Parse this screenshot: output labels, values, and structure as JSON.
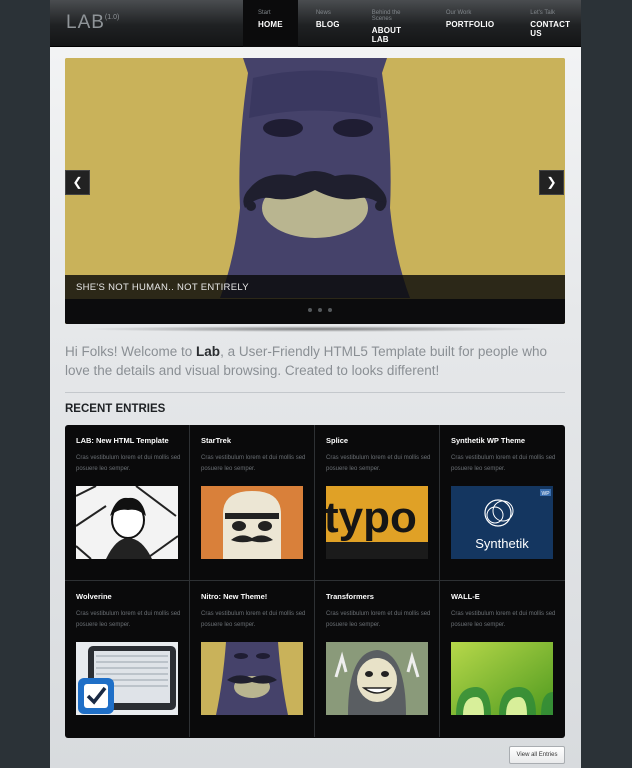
{
  "logo": {
    "text": "LAB",
    "version": "(1.0)"
  },
  "nav": [
    {
      "sub": "Start",
      "label": "HOME"
    },
    {
      "sub": "News",
      "label": "BLOG"
    },
    {
      "sub": "Behind the Scenes",
      "label": "ABOUT LAB"
    },
    {
      "sub": "Our Work",
      "label": "PORTFOLIO"
    },
    {
      "sub": "Let's Talk",
      "label": "CONTACT US"
    }
  ],
  "slider": {
    "caption": "SHE'S NOT HUMAN.. NOT ENTIRELY",
    "prev": "❮",
    "next": "❯",
    "bg_color": "#c9b25a"
  },
  "intro": {
    "pre": "Hi Folks! Welcome to ",
    "bold": "Lab",
    "post": ", a User-Friendly HTML5 Template built for people who love the details and visual browsing. Created to looks different!"
  },
  "recent": {
    "title": "RECENT ENTRIES",
    "entries": [
      {
        "title": "LAB: New HTML Template",
        "text": "Cras vestibulum lorem et dui mollis sed posuere leo semper."
      },
      {
        "title": "StarTrek",
        "text": "Cras vestibulum lorem et dui mollis sed posuere leo semper."
      },
      {
        "title": "Splice",
        "text": "Cras vestibulum lorem et dui mollis sed posuere leo semper."
      },
      {
        "title": "Synthetik WP Theme",
        "text": "Cras vestibulum lorem et dui mollis sed posuere leo semper."
      },
      {
        "title": "Wolverine",
        "text": "Cras vestibulum lorem et dui mollis sed posuere leo semper."
      },
      {
        "title": "Nitro: New Theme!",
        "text": "Cras vestibulum lorem et dui mollis sed posuere leo semper."
      },
      {
        "title": "Transformers",
        "text": "Cras vestibulum lorem et dui mollis sed posuere leo semper."
      },
      {
        "title": "WALL-E",
        "text": "Cras vestibulum lorem et dui mollis sed posuere leo semper."
      }
    ],
    "thumb_texts": {
      "typo": "typo",
      "synthetik": "Synthetik",
      "wp_badge": "WP"
    },
    "view_all": "View all Entries"
  }
}
